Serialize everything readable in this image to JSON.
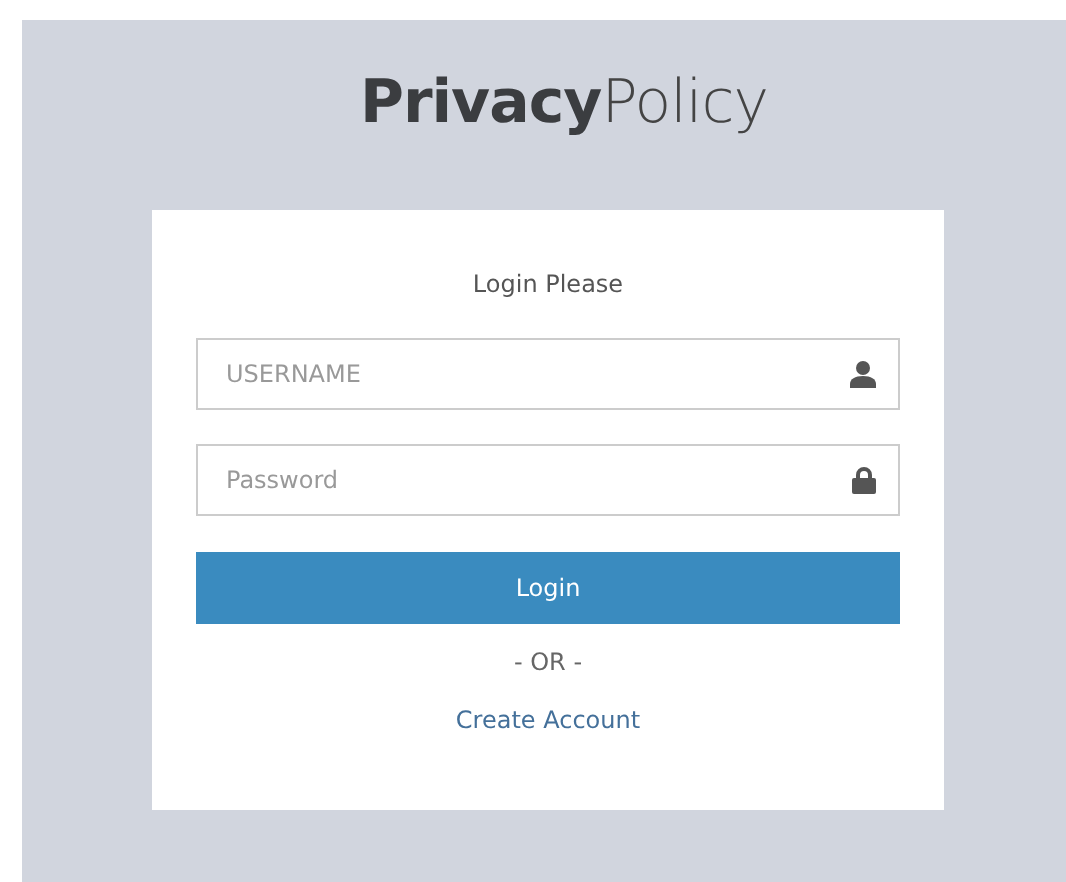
{
  "logo": "**Privacy**Policy",
  "login_card": {
    "heading": "Login Please",
    "fields": [
      {
        "kind": "user",
        "placeholder": "USERNAME"
      },
      {
        "kind": "lock",
        "placeholder": "Password"
      }
    ],
    "login_button": "Login",
    "separator": "- OR -",
    "create_account_link": "Create Account"
  }
}
